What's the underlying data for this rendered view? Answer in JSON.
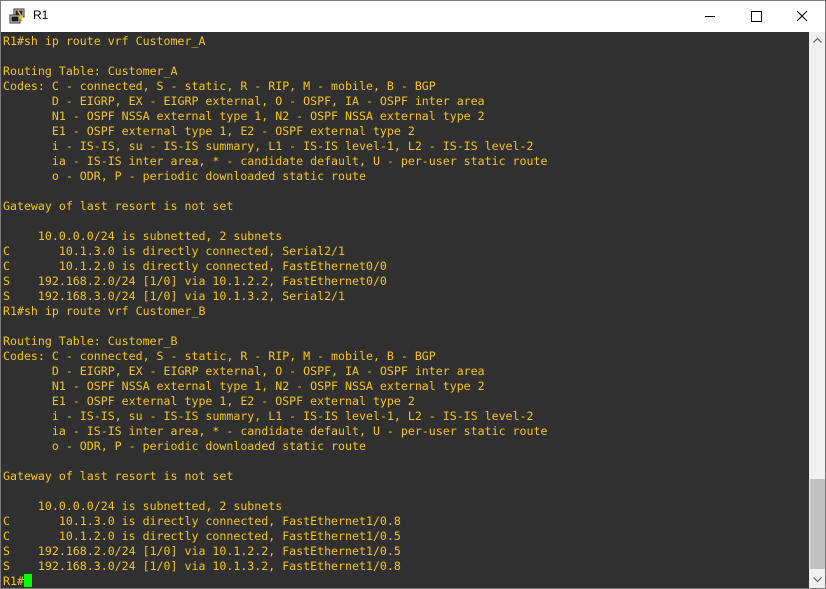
{
  "window": {
    "title": "R1",
    "icon": "putty-icon",
    "controls": {
      "minimize": "minimize-icon",
      "maximize": "maximize-icon",
      "close": "close-icon"
    }
  },
  "terminal": {
    "colors": {
      "background": "#303030",
      "text": "#f5c518",
      "cursor": "#00ff00"
    },
    "lines": [
      "R1#sh ip route vrf Customer_A",
      "",
      "Routing Table: Customer_A",
      "Codes: C - connected, S - static, R - RIP, M - mobile, B - BGP",
      "       D - EIGRP, EX - EIGRP external, O - OSPF, IA - OSPF inter area",
      "       N1 - OSPF NSSA external type 1, N2 - OSPF NSSA external type 2",
      "       E1 - OSPF external type 1, E2 - OSPF external type 2",
      "       i - IS-IS, su - IS-IS summary, L1 - IS-IS level-1, L2 - IS-IS level-2",
      "       ia - IS-IS inter area, * - candidate default, U - per-user static route",
      "       o - ODR, P - periodic downloaded static route",
      "",
      "Gateway of last resort is not set",
      "",
      "     10.0.0.0/24 is subnetted, 2 subnets",
      "C       10.1.3.0 is directly connected, Serial2/1",
      "C       10.1.2.0 is directly connected, FastEthernet0/0",
      "S    192.168.2.0/24 [1/0] via 10.1.2.2, FastEthernet0/0",
      "S    192.168.3.0/24 [1/0] via 10.1.3.2, Serial2/1",
      "R1#sh ip route vrf Customer_B",
      "",
      "Routing Table: Customer_B",
      "Codes: C - connected, S - static, R - RIP, M - mobile, B - BGP",
      "       D - EIGRP, EX - EIGRP external, O - OSPF, IA - OSPF inter area",
      "       N1 - OSPF NSSA external type 1, N2 - OSPF NSSA external type 2",
      "       E1 - OSPF external type 1, E2 - OSPF external type 2",
      "       i - IS-IS, su - IS-IS summary, L1 - IS-IS level-1, L2 - IS-IS level-2",
      "       ia - IS-IS inter area, * - candidate default, U - per-user static route",
      "       o - ODR, P - periodic downloaded static route",
      "",
      "Gateway of last resort is not set",
      "",
      "     10.0.0.0/24 is subnetted, 2 subnets",
      "C       10.1.3.0 is directly connected, FastEthernet1/0.8",
      "C       10.1.2.0 is directly connected, FastEthernet1/0.5",
      "S    192.168.2.0/24 [1/0] via 10.1.2.2, FastEthernet1/0.5",
      "S    192.168.3.0/24 [1/0] via 10.1.3.2, FastEthernet1/0.8"
    ],
    "prompt": "R1#"
  },
  "scrollbar": {
    "up_icon": "scroll-up-arrow-icon",
    "down_icon": "scroll-down-arrow-icon"
  }
}
